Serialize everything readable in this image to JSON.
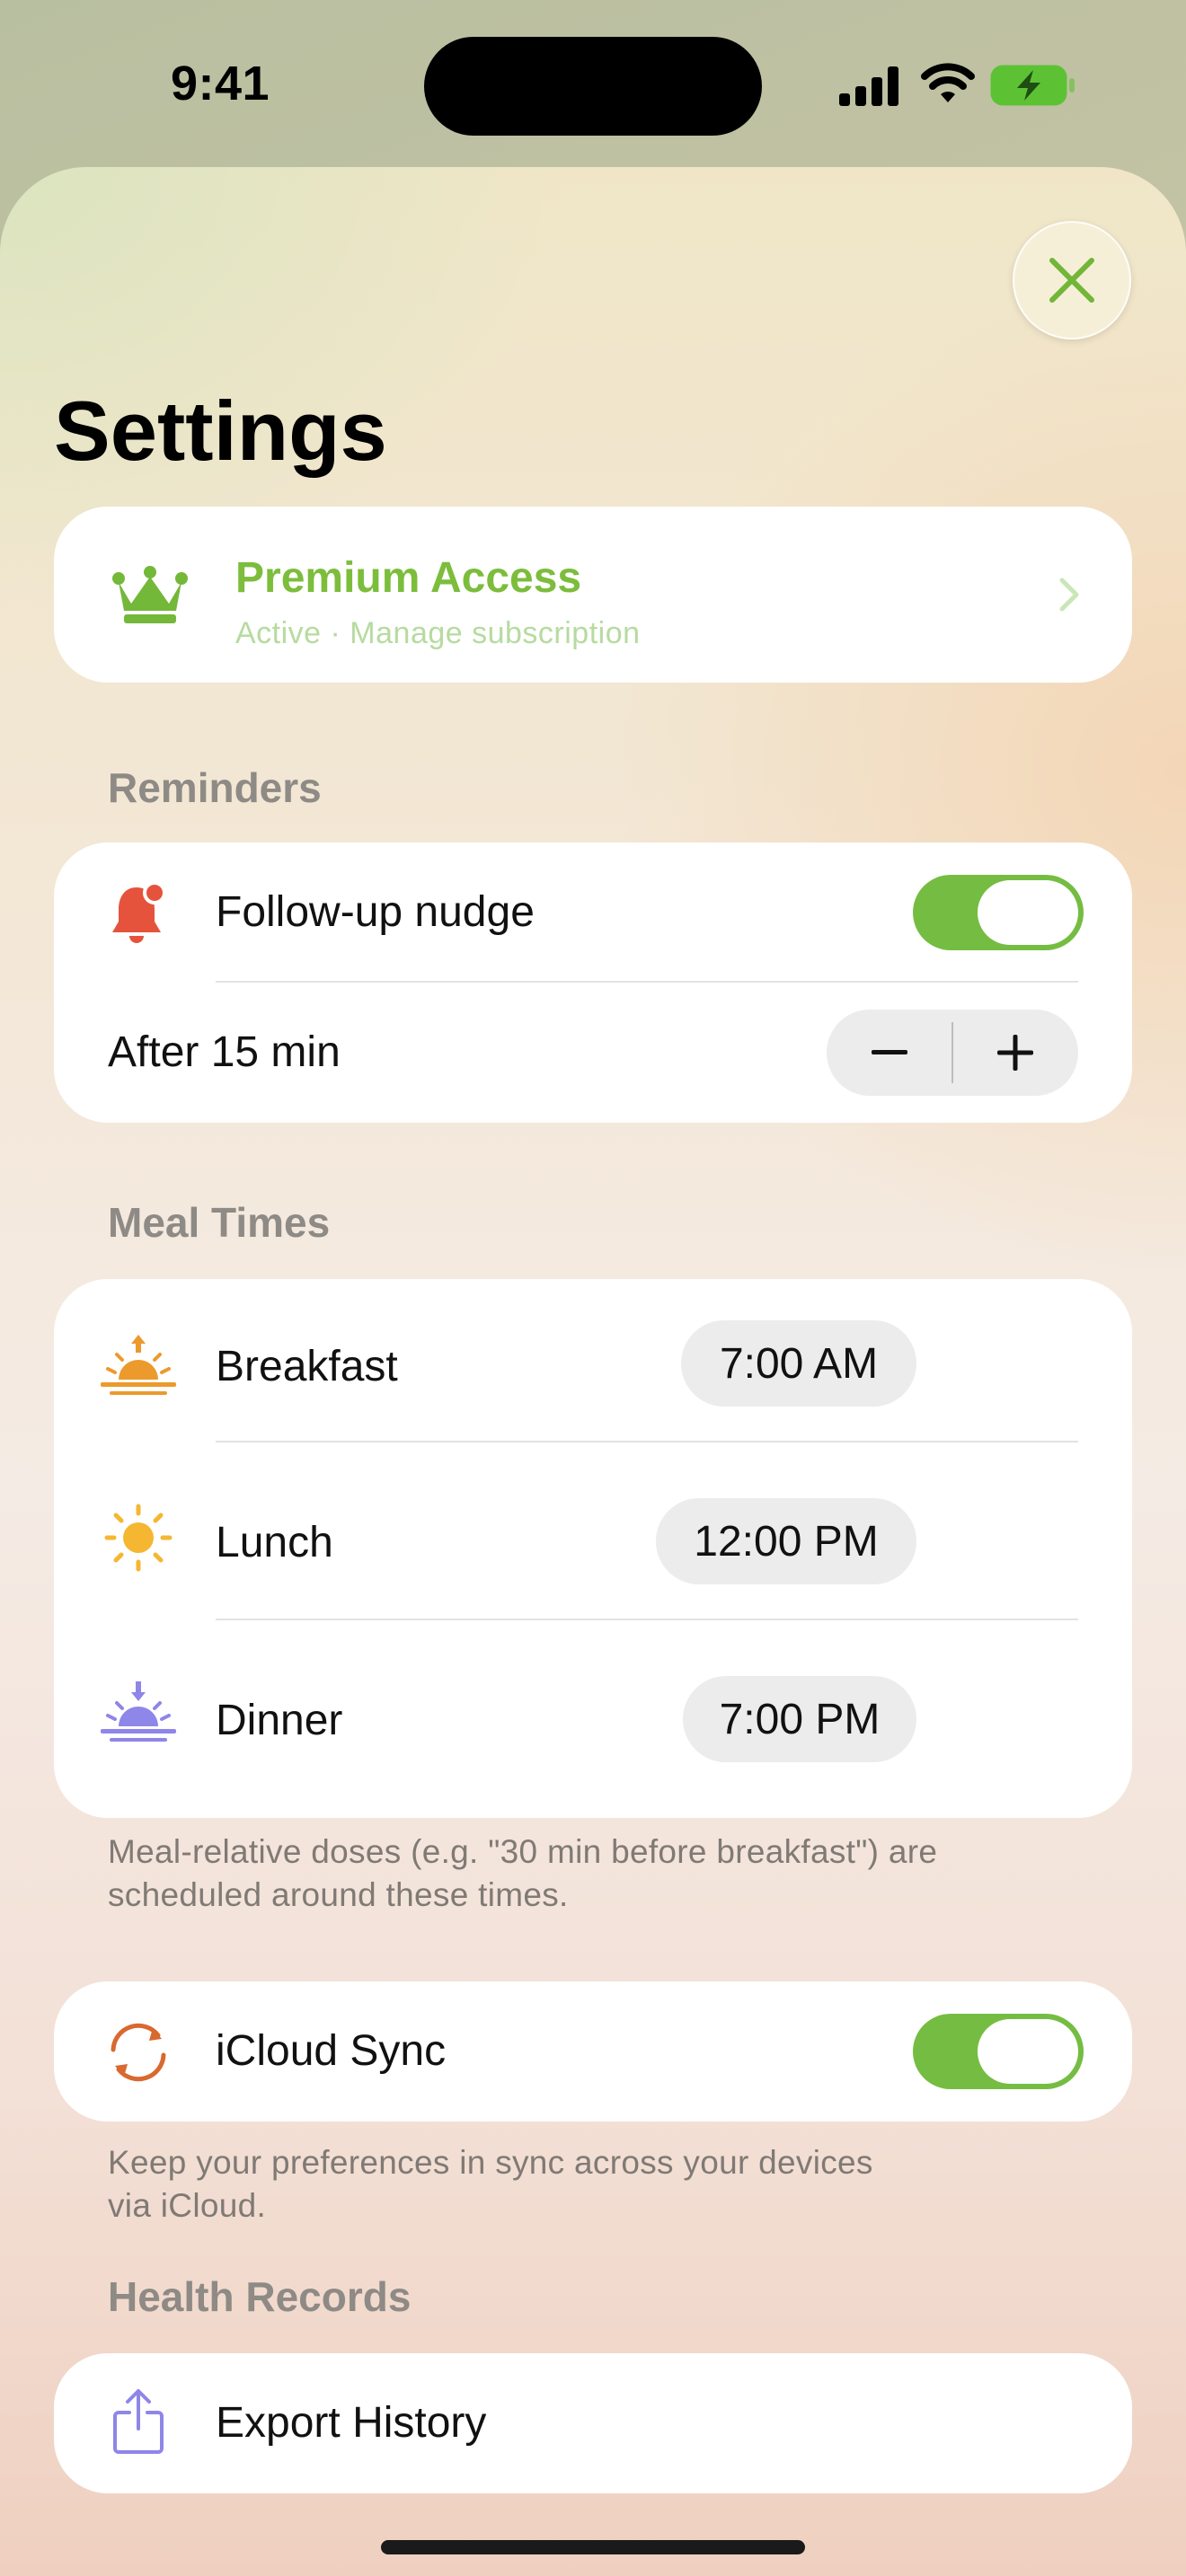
{
  "status_bar": {
    "time": "9:41"
  },
  "header": {
    "title": "Settings"
  },
  "premium": {
    "title": "Premium Access",
    "subtitle": "Active · Manage subscription"
  },
  "reminders": {
    "section_label": "Reminders",
    "follow_up_label": "Follow-up nudge",
    "follow_up_enabled": true,
    "delay_label": "After 15 min"
  },
  "meal_times": {
    "section_label": "Meal Times",
    "items": [
      {
        "label": "Breakfast",
        "time": "7:00 AM",
        "icon": "sunrise-icon"
      },
      {
        "label": "Lunch",
        "time": "12:00 PM",
        "icon": "sun-icon"
      },
      {
        "label": "Dinner",
        "time": "7:00 PM",
        "icon": "sunset-icon"
      }
    ],
    "footnote_line1": "Meal-relative doses (e.g. \"30 min before breakfast\") are",
    "footnote_line2": "scheduled around these times."
  },
  "icloud": {
    "label": "iCloud Sync",
    "enabled": true,
    "footnote_line1": "Keep your preferences in sync across your devices",
    "footnote_line2": "via iCloud."
  },
  "health_records": {
    "section_label": "Health Records",
    "export_label": "Export History"
  },
  "colors": {
    "accent_green": "#75bd42",
    "bell_red": "#e5533d",
    "sync_orange": "#d9692e",
    "export_purple": "#8e86e8",
    "sun_yellow": "#f5b731"
  }
}
